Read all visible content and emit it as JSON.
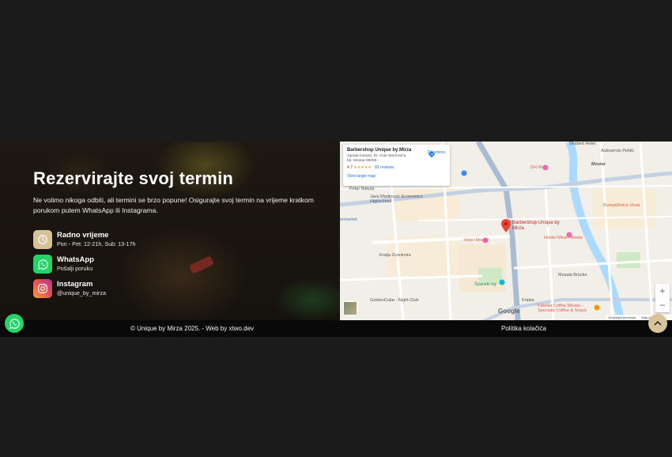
{
  "booking": {
    "title": "Rezervirajte svoj termin",
    "description": "Ne volimo nikoga odbiti, ali termini se brzo popune! Osigurajte svoj termin na vrijeme kratkom porukom putem WhatsApp ili Instagrama.",
    "items": [
      {
        "title": "Radno vrijeme",
        "sub": "Pon - Pet: 12-21h, Sub: 13-17h",
        "icon": "clock-icon"
      },
      {
        "title": "WhatsApp",
        "sub": "Pošalji poruku",
        "icon": "whatsapp-icon"
      },
      {
        "title": "Instagram",
        "sub": "@unique_by_mirza",
        "icon": "instagram-icon"
      }
    ]
  },
  "map": {
    "card": {
      "name": "Barbershop Unique by Mirza",
      "address": "zgrada Integra, Dr. Ante Starčevića bb, Mostar 88000",
      "rating": "4.7",
      "stars": "★★★★★",
      "reviews": "82 reviews",
      "directions": "Directions",
      "larger": "View larger map"
    },
    "pin_label": "Barbershop Unique by Mirza",
    "labels": {
      "student_hotel": "Student Hotel",
      "autoservis": "Autoservis Pehlić",
      "mostar": "Mostar",
      "delrio": "Dél Rio",
      "petar_bakula": "Petar Bakula",
      "school": "Java Martinovic Economics Highschool",
      "market": "ermarket",
      "hotel_mostar": "Hotel Mostar",
      "hostel": "Hostel Miran Mostar",
      "buregdzinica": "Buregdžinica Visak",
      "kralja_zvonimira": "Kralja Zvonimira",
      "kraljice_katarine": "Kraljice Katarine",
      "spanski_trg": "Španski trg",
      "musala": "Musala Brücke",
      "kripka": "Kripka",
      "fabrika": "Fabrika Coffee Mostar - Specialty Coffee & Snack",
      "golden_cube": "GoldenCube - Night Club",
      "m61": "M6.1",
      "m171": "M17",
      "keyboard": "Keyboard shortcuts",
      "mapdata": "Map data ©2025",
      "terms": "Terms",
      "report": "Report a map error"
    },
    "google": "Google",
    "zoom_in": "+",
    "zoom_out": "−"
  },
  "footer": {
    "copyright": "© Unique by Mirza 2025. - Web by  xtwo.dev",
    "policy": "Politika kolačića"
  },
  "colors": {
    "accent": "#d8c29a",
    "whatsapp": "#25d366",
    "background": "#1b1b1b"
  }
}
